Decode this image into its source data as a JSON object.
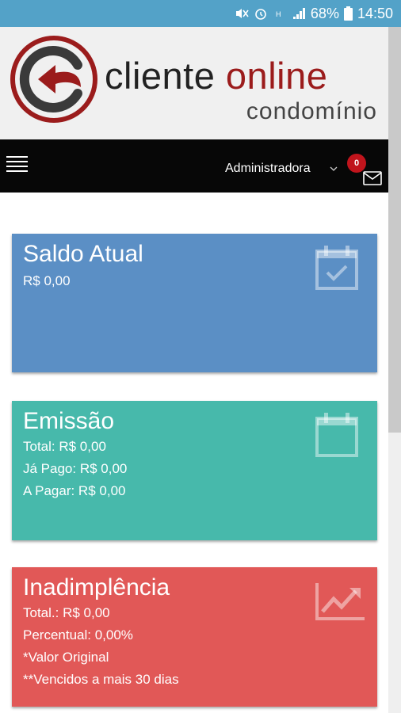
{
  "status_bar": {
    "battery": "68%",
    "time": "14:50",
    "icons": [
      "mute-icon",
      "alarm-icon",
      "hspa-icon",
      "signal-icon",
      "battery-icon"
    ]
  },
  "header": {
    "logo_word1": "cliente",
    "logo_word2": "online",
    "logo_subtitle": "condomínio"
  },
  "navbar": {
    "menu_icon": "hamburger-icon",
    "user": "Administradora",
    "notification_count": "0",
    "mail_icon": "envelope-icon"
  },
  "cards": {
    "saldo": {
      "title": "Saldo Atual",
      "lines": [
        "R$ 0,00"
      ],
      "color": "#5b8fc5",
      "icon": "calendar-check-icon"
    },
    "emissao": {
      "title": "Emissão",
      "lines": [
        "Total: R$ 0,00",
        "Já Pago: R$ 0,00",
        "A Pagar: R$ 0,00"
      ],
      "color": "#47b9ab",
      "icon": "calendar-icon"
    },
    "inadimplencia": {
      "title": "Inadimplência",
      "lines": [
        "Total.: R$ 0,00",
        "Percentual: 0,00%",
        "*Valor Original",
        "**Vencidos a mais 30 dias"
      ],
      "color": "#e15857",
      "icon": "line-chart-icon"
    }
  },
  "colors": {
    "status_bar": "#53a2c8",
    "navbar": "#070707",
    "brand_red": "#9b1c1c",
    "badge": "#c0141c"
  }
}
